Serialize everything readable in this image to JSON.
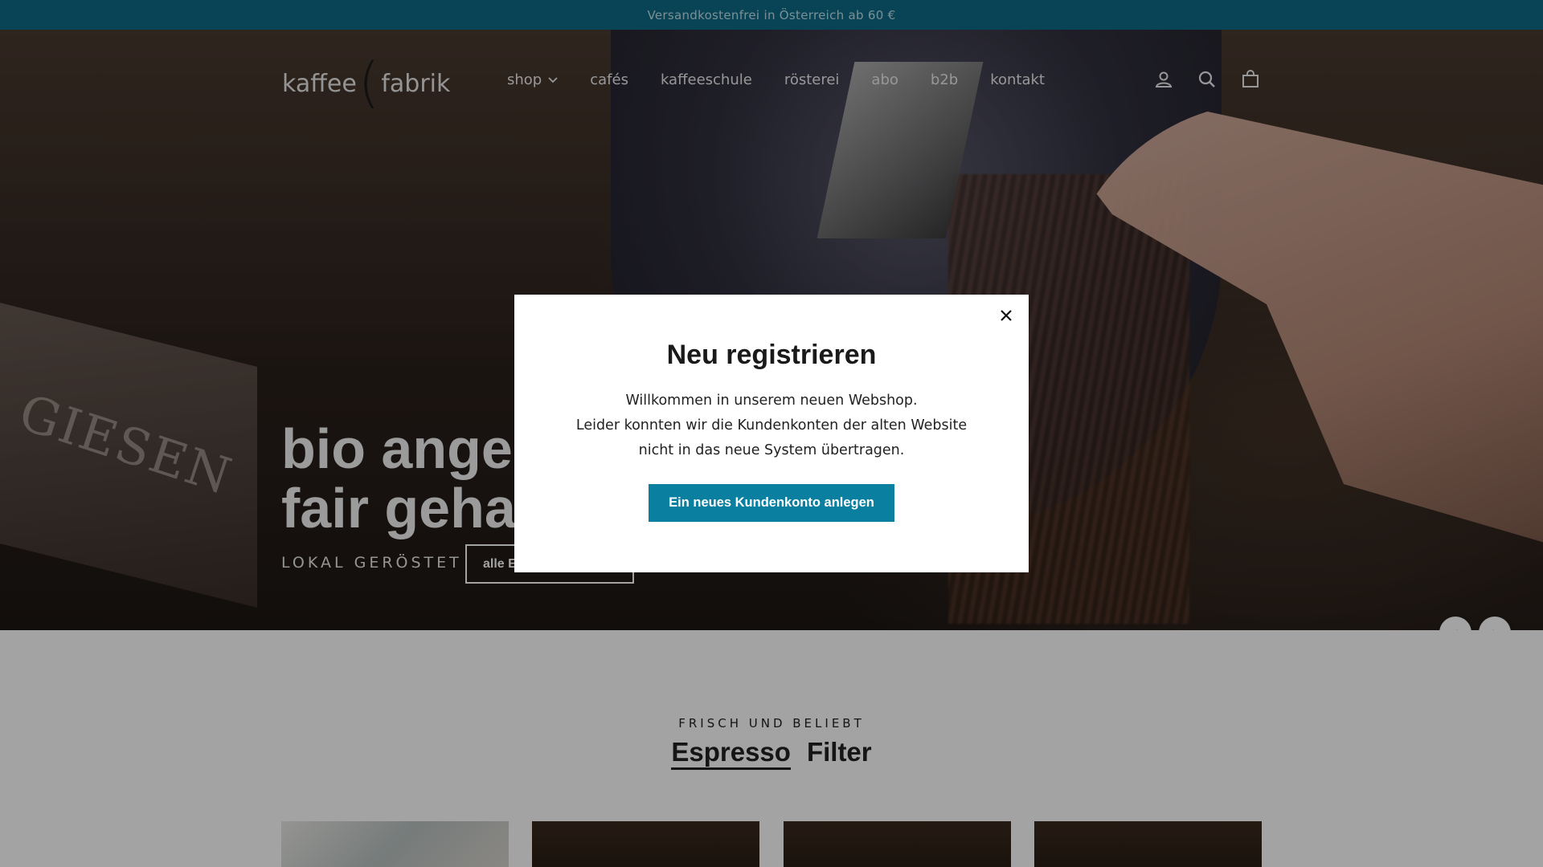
{
  "announcement": {
    "text": "Versandkostenfrei in Österreich ab 60 €"
  },
  "logo": {
    "word1": "kaffee",
    "paren": "(",
    "word2": "fabrik"
  },
  "nav": {
    "items": [
      {
        "label": "shop",
        "has_dropdown": true
      },
      {
        "label": "cafés"
      },
      {
        "label": "kaffeeschule"
      },
      {
        "label": "rösterei"
      },
      {
        "label": "abo"
      },
      {
        "label": "b2b"
      },
      {
        "label": "kontakt"
      }
    ],
    "icons": [
      "account-icon",
      "search-icon",
      "cart-icon"
    ]
  },
  "hero": {
    "title_line1": "bio angel",
    "title_line2": "fair geha",
    "subtitle": "LOKAL GERÖSTET",
    "button_label": "alle E",
    "panel_text": "GIESEN",
    "arrows": {
      "prev": "‹",
      "next": "›"
    }
  },
  "section": {
    "eyebrow": "FRISCH UND BELIEBT",
    "tabs": [
      {
        "label": "Espresso",
        "active": true
      },
      {
        "label": "Filter",
        "active": false
      }
    ]
  },
  "modal": {
    "title": "Neu registrieren",
    "body_line1": "Willkommen in unserem neuen Webshop.",
    "body_line2": "Leider konnten wir die Kundenkonten der alten Website",
    "body_line3": "nicht in das neue System übertragen.",
    "button_label": "Ein neues Kundenkonto anlegen",
    "close_icon": "close-icon"
  },
  "colors": {
    "announcement_bg": "#0e6b86",
    "modal_button_bg": "#0a7fa0",
    "overlay": "rgba(0,0,0,0.36)"
  }
}
